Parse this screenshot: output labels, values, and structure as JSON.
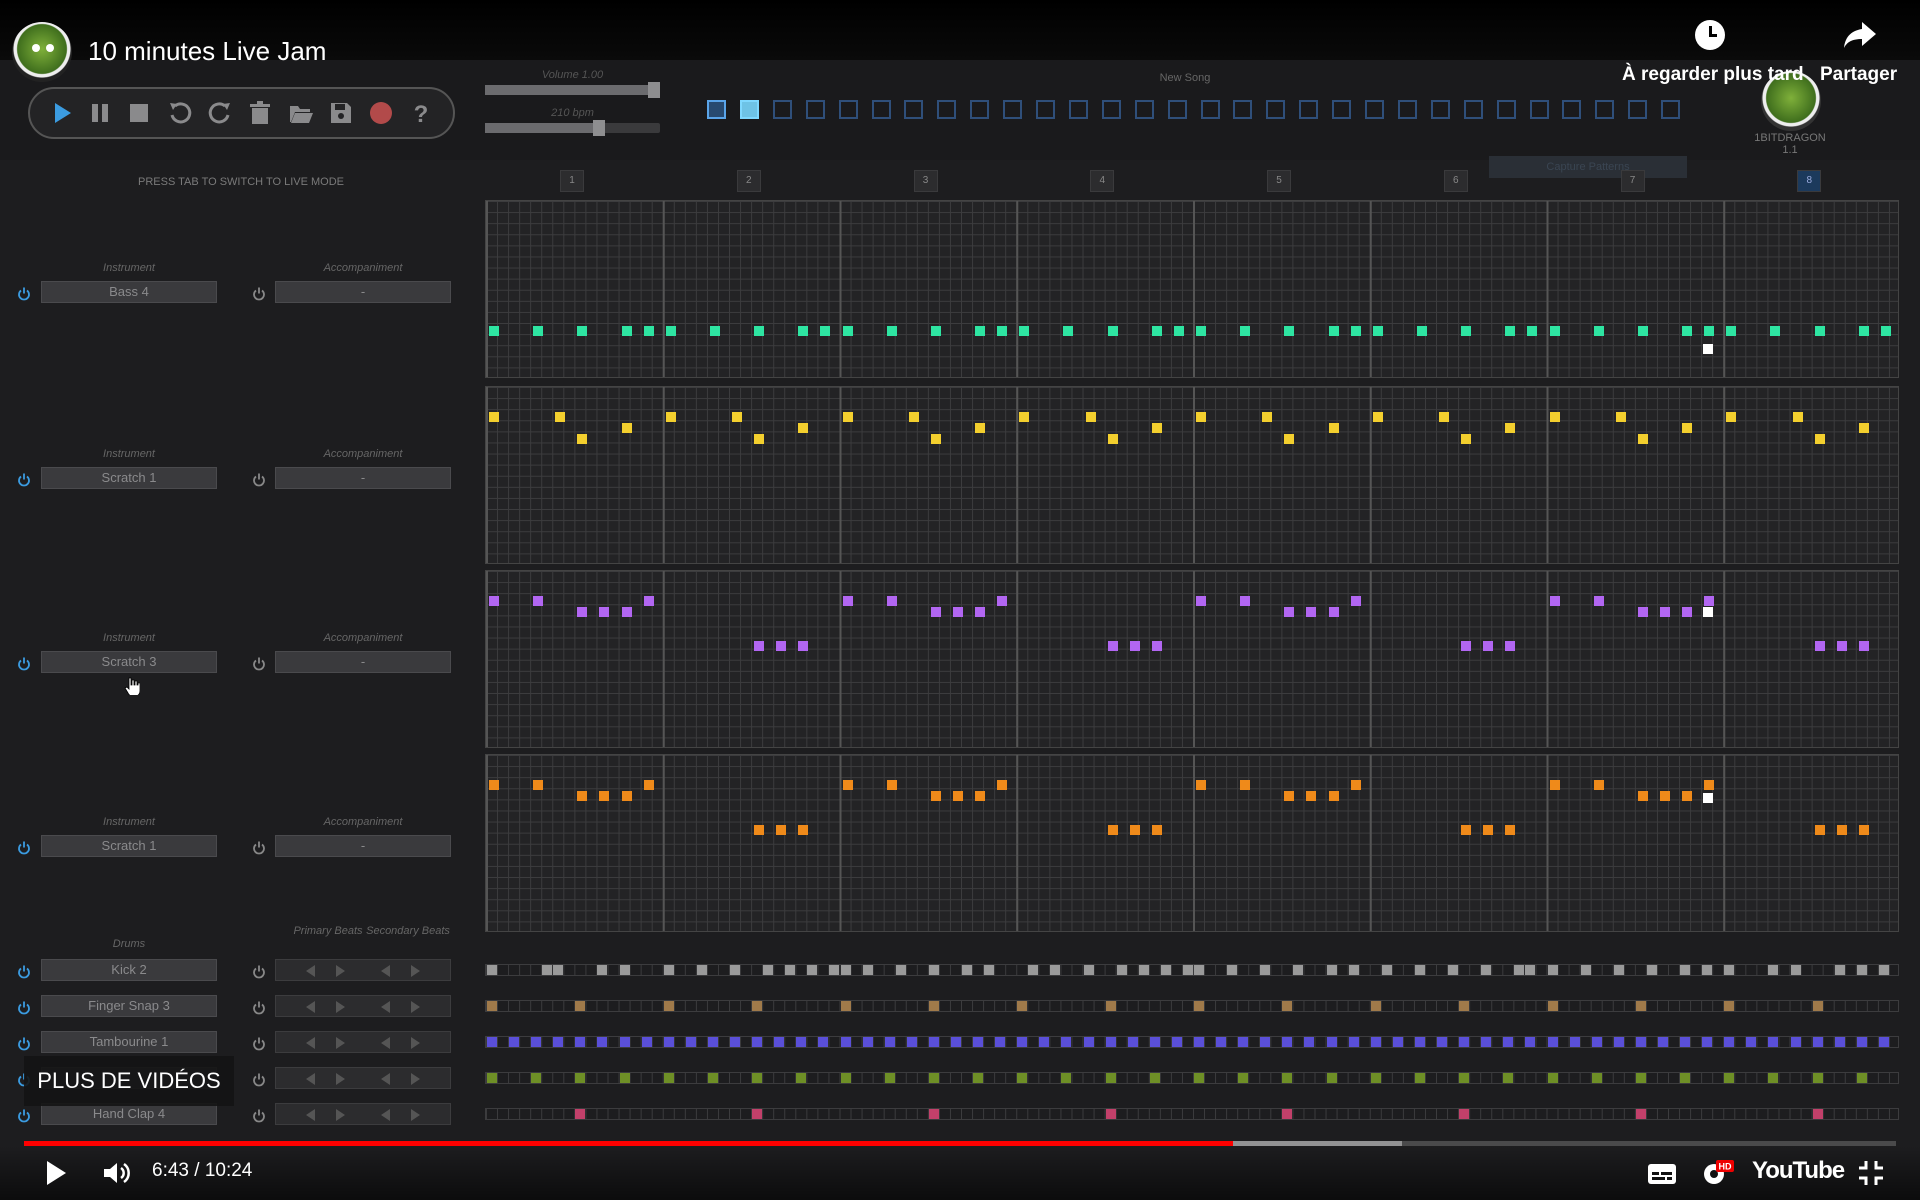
{
  "video": {
    "title": "10 minutes Live Jam",
    "watch_later": "À regarder plus tard",
    "share": "Partager",
    "more_videos": "PLUS DE VIDÉOS",
    "time": "6:43 / 10:24",
    "progress_fraction": 0.646,
    "buffered_fraction": 0.736,
    "brand": "YouTube"
  },
  "app": {
    "volume_label": "Volume 1.00",
    "tempo_label": "210 bpm",
    "volume_value": 1.0,
    "tempo_value": 210,
    "new_song": "New Song",
    "brand_name": "1BITDRAGON",
    "brand_version": "1.1",
    "capture_label": "Capture Patterns",
    "live_hint": "PRESS TAB TO SWITCH TO LIVE MODE",
    "bar_numbers": [
      "1",
      "2",
      "3",
      "4",
      "5",
      "6",
      "7",
      "8"
    ],
    "active_bar": "8",
    "pattern_slots": 30,
    "active_pattern": 0,
    "loop_pattern": 1,
    "transport": [
      "play",
      "pause",
      "stop",
      "undo",
      "redo",
      "delete",
      "open",
      "save",
      "record",
      "help"
    ],
    "colors": {
      "bass": "#2ee5a2",
      "scratch1": "#f3cf2e",
      "scratch3": "#b266f2",
      "scratch1b": "#ef8a1a",
      "kick": "#9a9a9a",
      "snap": "#a07a4a",
      "tambourine": "#5a4fd8",
      "drum4": "#6e8f26",
      "clap": "#c2406a",
      "accent": "#3b9be0"
    }
  },
  "labels": {
    "instrument": "Instrument",
    "accompaniment": "Accompaniment",
    "drums": "Drums",
    "primary_beats": "Primary Beats",
    "secondary_beats": "Secondary Beats"
  },
  "tracks": [
    {
      "instrument": "Bass 4",
      "accompaniment": "-"
    },
    {
      "instrument": "Scratch 1",
      "accompaniment": "-"
    },
    {
      "instrument": "Scratch 3",
      "accompaniment": "-"
    },
    {
      "instrument": "Scratch 1",
      "accompaniment": "-"
    }
  ],
  "drums": [
    {
      "name": "Kick 2"
    },
    {
      "name": "Finger Snap 3"
    },
    {
      "name": "Tambourine 1"
    },
    {
      "name": ""
    },
    {
      "name": "Hand Clap 4"
    }
  ]
}
